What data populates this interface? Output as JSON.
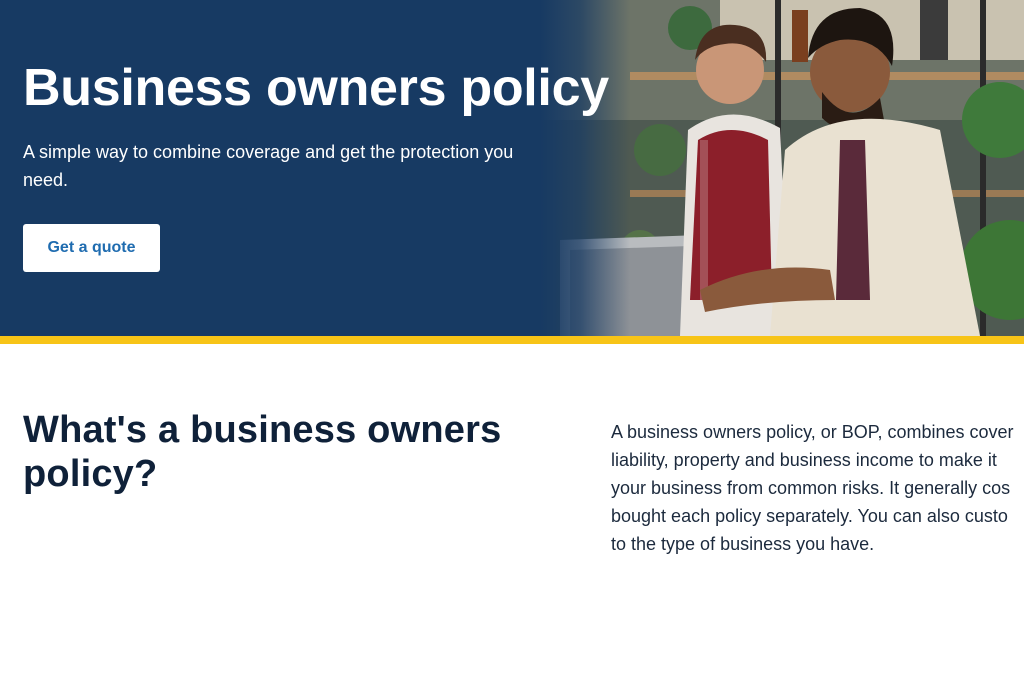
{
  "hero": {
    "title": "Business owners policy",
    "subtitle": "A simple way to combine coverage and get the protection you need.",
    "cta_label": "Get a quote",
    "photo": "two small business owners looking at a laptop in a plant shop"
  },
  "section": {
    "heading": "What's a business owners policy?",
    "body_lines": [
      "A business owners policy, or BOP, combines cover",
      "liability, property and business income to make it",
      "your business from common risks. It generally cos",
      "bought each policy separately. You can also custo",
      "to the type of business you have."
    ]
  },
  "colors": {
    "hero_background": "#173a63",
    "accent_bar": "#f7c417",
    "cta_text": "#1f6cb0",
    "heading_text": "#0f2139"
  }
}
